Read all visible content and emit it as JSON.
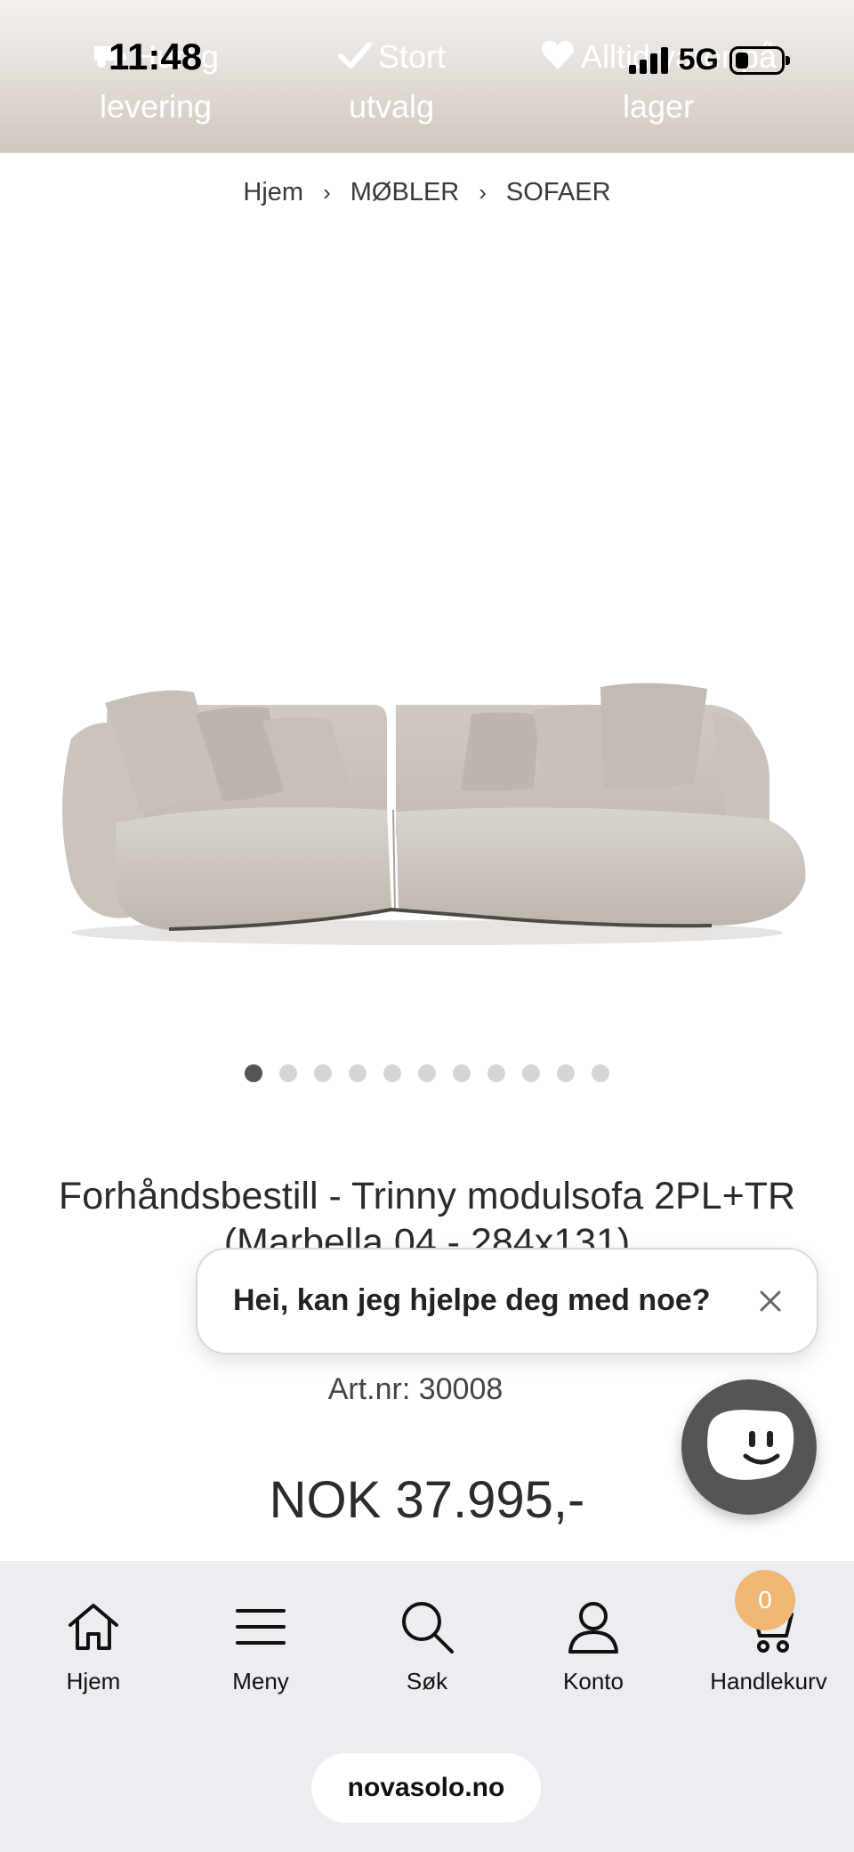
{
  "status_bar": {
    "time": "11:48",
    "network": "5G"
  },
  "top_banner": {
    "usps": [
      {
        "line1": "Hurtig",
        "line2": "levering",
        "icon": "truck-icon"
      },
      {
        "line1": "Stort",
        "line2": "utvalg",
        "icon": "checkmark-icon"
      },
      {
        "line1": "Alltid varer på",
        "line2": "lager",
        "icon": "heart-icon"
      }
    ]
  },
  "breadcrumb": {
    "items": [
      "Hjem",
      "MØBLER",
      "SOFAER"
    ],
    "separator": "›"
  },
  "gallery": {
    "image_count": 11,
    "active_index": 0
  },
  "product": {
    "title": "Forhåndsbestill - Trinny modulsofa 2PL+TR (Marbella 04 - 284x131)",
    "article_number": "Art.nr: 30008",
    "price": "NOK 37.995,-"
  },
  "chat": {
    "greeting": "Hei, kan jeg hjelpe deg med noe?"
  },
  "bottom_nav": {
    "items": [
      {
        "label": "Hjem",
        "icon": "home-icon"
      },
      {
        "label": "Meny",
        "icon": "menu-icon"
      },
      {
        "label": "Søk",
        "icon": "search-icon"
      },
      {
        "label": "Konto",
        "icon": "user-icon"
      },
      {
        "label": "Handlekurv",
        "icon": "cart-icon"
      }
    ],
    "cart_count": "0"
  },
  "browser": {
    "url": "novasolo.no"
  },
  "colors": {
    "accent_badge": "#f0b774",
    "chat_launcher": "#555555",
    "nav_background": "#ebedf0"
  }
}
